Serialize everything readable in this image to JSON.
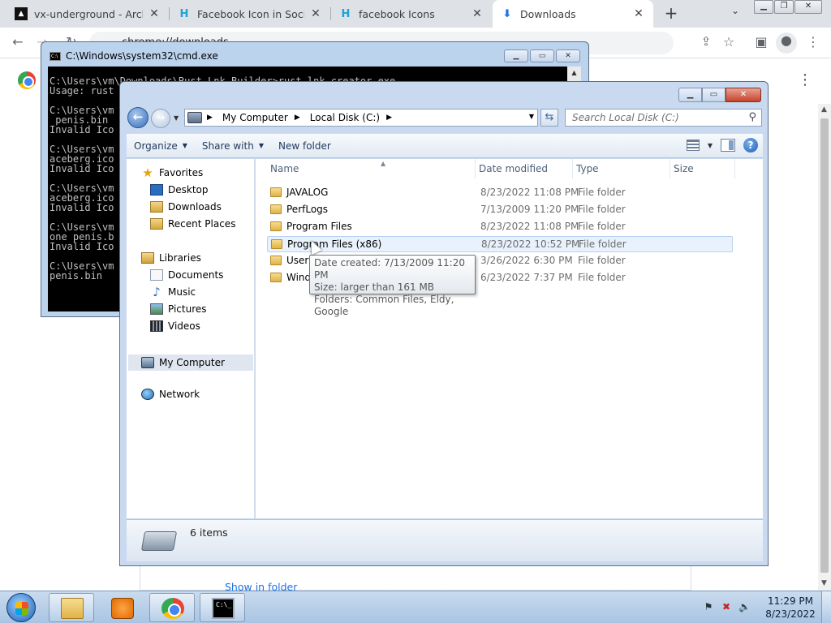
{
  "browser": {
    "tabs": [
      {
        "label": "vx-underground - Archive",
        "icon": "vx-favicon"
      },
      {
        "label": "Facebook Icon in Social icons",
        "icon": "h-favicon"
      },
      {
        "label": "facebook Icons",
        "icon": "h-favicon"
      },
      {
        "label": "Downloads",
        "icon": "download-icon",
        "active": true
      }
    ],
    "url": "chrome://downloads",
    "show_in_folder": "Show in folder"
  },
  "cmd": {
    "title": "C:\\Windows\\system32\\cmd.exe",
    "lines": [
      "C:\\Users\\vm\\Downloads\\Rust Lnk Builder>rust_lnk_creator.exe",
      "Usage: rust",
      "",
      "C:\\Users\\vm",
      " penis.bin",
      "Invalid Ico",
      "",
      "C:\\Users\\vm",
      "aceberg.ico",
      "Invalid Ico",
      "",
      "C:\\Users\\vm",
      "aceberg.ico",
      "Invalid Ico",
      "",
      "C:\\Users\\vm",
      "one penis.b",
      "Invalid Ico",
      "",
      "C:\\Users\\vm",
      "penis.bin"
    ]
  },
  "explorer": {
    "breadcrumb": [
      "My Computer",
      "Local Disk (C:)"
    ],
    "search_placeholder": "Search Local Disk (C:)",
    "toolbar": {
      "organize": "Organize",
      "share_with": "Share with",
      "new_folder": "New folder"
    },
    "nav": {
      "favorites": "Favorites",
      "desktop": "Desktop",
      "downloads": "Downloads",
      "recent_places": "Recent Places",
      "libraries": "Libraries",
      "documents": "Documents",
      "music": "Music",
      "pictures": "Pictures",
      "videos": "Videos",
      "my_computer": "My Computer",
      "network": "Network"
    },
    "columns": {
      "name": "Name",
      "date_modified": "Date modified",
      "type": "Type",
      "size": "Size"
    },
    "files": [
      {
        "name": "JAVALOG",
        "date": "8/23/2022 11:08 PM",
        "type": "File folder"
      },
      {
        "name": "PerfLogs",
        "date": "7/13/2009 11:20 PM",
        "type": "File folder"
      },
      {
        "name": "Program Files",
        "date": "8/23/2022 11:08 PM",
        "type": "File folder"
      },
      {
        "name": "Program Files (x86)",
        "date": "8/23/2022 10:52 PM",
        "type": "File folder"
      },
      {
        "name": "Users",
        "date": "3/26/2022 6:30 PM",
        "type": "File folder"
      },
      {
        "name": "Windows",
        "date": "6/23/2022 7:37 PM",
        "type": "File folder"
      }
    ],
    "tooltip": {
      "date_created": "Date created: 7/13/2009 11:20 PM",
      "size": "Size: larger than 161 MB",
      "folders": "Folders: Common Files, Eldy, Google"
    },
    "item_count": "6 items"
  },
  "taskbar": {
    "time": "11:29 PM",
    "date": "8/23/2022"
  }
}
